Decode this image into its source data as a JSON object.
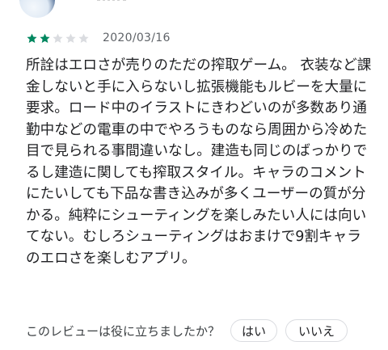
{
  "review": {
    "rating": 2,
    "max_rating": 5,
    "date": "2020/03/16",
    "body": "所詮はエロさが売りのただの搾取ゲーム。 衣装など課金しないと手に入らないし拡張機能もルビーを大量に要求。ロード中のイラストにきわどいのが多数あり通勤中などの電車の中でやろうものなら周囲から冷めた目で見られる事間違いなし。建造も同じのばっかりでるし建造に関しても搾取スタイル。キャラのコメントにたいしても下品な書き込みが多くユーザーの質が分かる。純粋にシューティングを楽しみたい人には向いてない。むしろシューティングはおまけで9割キャラのエロさを楽しむアプリ。"
  },
  "helpful": {
    "question": "このレビューは役に立ちましたか？",
    "yes_label": "はい",
    "no_label": "いいえ"
  },
  "colors": {
    "star_filled": "#01875f",
    "star_empty": "#dadce0",
    "text_primary": "#202124",
    "text_secondary": "#5f6368",
    "pill_border": "#dadce0"
  },
  "icons": {
    "star_filled": "star-filled-icon",
    "star_empty": "star-empty-icon"
  }
}
